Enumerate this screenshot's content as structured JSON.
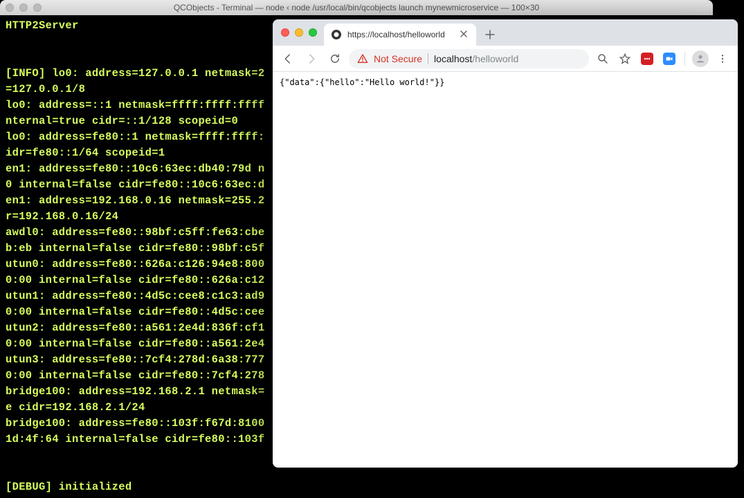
{
  "terminal": {
    "title": "QCObjects - Terminal — node ‹ node /usr/local/bin/qcobjects launch mynewmicroservice — 100×30",
    "lines": [
      "HTTP2Server",
      "",
      "",
      "[INFO] lo0: address=127.0.0.1 netmask=2",
      "=127.0.0.1/8",
      "lo0: address=::1 netmask=ffff:ffff:ffff",
      "nternal=true cidr=::1/128 scopeid=0",
      "lo0: address=fe80::1 netmask=ffff:ffff:",
      "idr=fe80::1/64 scopeid=1",
      "en1: address=fe80::10c6:63ec:db40:79d n",
      "0 internal=false cidr=fe80::10c6:63ec:d",
      "en1: address=192.168.0.16 netmask=255.2",
      "r=192.168.0.16/24",
      "awdl0: address=fe80::98bf:c5ff:fe63:cbe",
      "b:eb internal=false cidr=fe80::98bf:c5f",
      "utun0: address=fe80::626a:c126:94e8:800",
      "0:00 internal=false cidr=fe80::626a:c12",
      "utun1: address=fe80::4d5c:cee8:c1c3:ad9",
      "0:00 internal=false cidr=fe80::4d5c:cee",
      "utun2: address=fe80::a561:2e4d:836f:cf1",
      "0:00 internal=false cidr=fe80::a561:2e4",
      "utun3: address=fe80::7cf4:278d:6a38:777",
      "0:00 internal=false cidr=fe80::7cf4:278",
      "bridge100: address=192.168.2.1 netmask=",
      "e cidr=192.168.2.1/24",
      "bridge100: address=fe80::103f:f67d:8100",
      "1d:4f:64 internal=false cidr=fe80::103f",
      "",
      "",
      "[DEBUG] initialized"
    ]
  },
  "browser": {
    "tab": {
      "title": "https://localhost/helloworld"
    },
    "address": {
      "not_secure": "Not Secure",
      "host": "localhost",
      "path": "/helloworld"
    },
    "content": "{\"data\":{\"hello\":\"Hello world!\"}}"
  }
}
